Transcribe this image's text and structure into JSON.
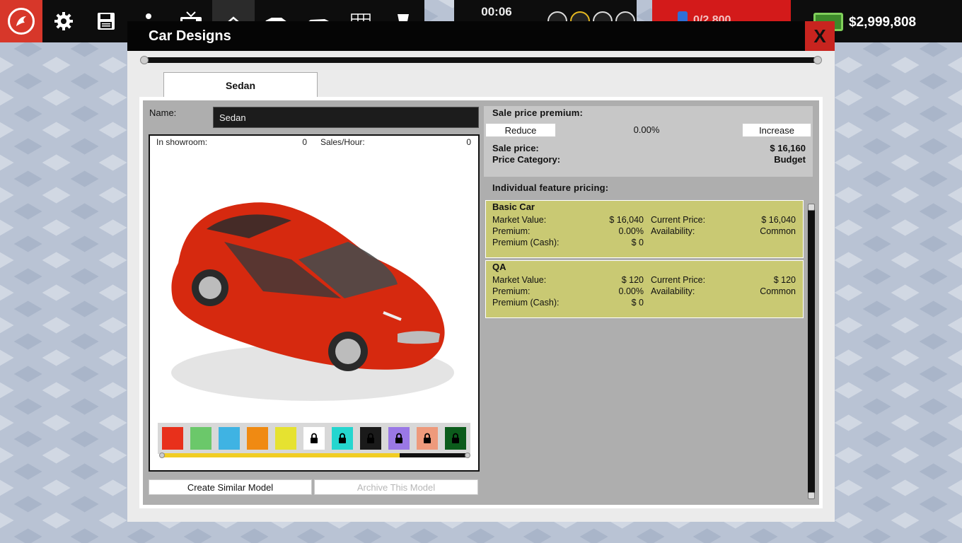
{
  "topbar": {
    "time": "00:06",
    "red_indicator_text": "0/2,800",
    "money": "$2,999,808",
    "icons": [
      "logo-icon",
      "gear-icon",
      "save-icon",
      "worker-icon",
      "tv-icon",
      "factory-icon",
      "car-icon",
      "sedan-icon",
      "grid-icon",
      "trophy-icon"
    ],
    "speed_buttons": [
      "pause-icon",
      "play-icon",
      "fast-forward-icon",
      "fastest-forward-icon"
    ]
  },
  "dialog": {
    "title": "Car Designs",
    "close_label": "X",
    "tab_label": "Sedan"
  },
  "design": {
    "name_label": "Name:",
    "name_value": "Sedan",
    "showroom_label": "In showroom:",
    "showroom_value": "0",
    "sales_label": "Sales/Hour:",
    "sales_value": "0",
    "car_color": "#d6290f",
    "swatches": [
      {
        "color": "#e8301b",
        "locked": false
      },
      {
        "color": "#6bc86a",
        "locked": false
      },
      {
        "color": "#3fb3e3",
        "locked": false
      },
      {
        "color": "#f08a12",
        "locked": false
      },
      {
        "color": "#e6e230",
        "locked": false
      },
      {
        "color": "#ffffff",
        "locked": true
      },
      {
        "color": "#25d6cf",
        "locked": true
      },
      {
        "color": "#1a1a1a",
        "locked": true
      },
      {
        "color": "#9a78e6",
        "locked": true
      },
      {
        "color": "#ee9a7c",
        "locked": true
      },
      {
        "color": "#0c5c1c",
        "locked": true
      }
    ],
    "swatch_scroll_fraction": 0.78,
    "create_similar_label": "Create Similar Model",
    "archive_label": "Archive This Model"
  },
  "pricing": {
    "premium_title": "Sale price premium:",
    "reduce_label": "Reduce",
    "premium_value": "0.00%",
    "increase_label": "Increase",
    "sale_price_label": "Sale price:",
    "sale_price_value": "$ 16,160",
    "category_label": "Price Category:",
    "category_value": "Budget",
    "features_title": "Individual feature pricing:",
    "features": [
      {
        "name": "Basic Car",
        "market_value_label": "Market Value:",
        "market_value": "$ 16,040",
        "premium_label": "Premium:",
        "premium": "0.00%",
        "premium_cash_label": "Premium (Cash):",
        "premium_cash": "$ 0",
        "current_price_label": "Current Price:",
        "current_price": "$ 16,040",
        "availability_label": "Availability:",
        "availability": "Common"
      },
      {
        "name": "QA",
        "market_value_label": "Market Value:",
        "market_value": "$ 120",
        "premium_label": "Premium:",
        "premium": "0.00%",
        "premium_cash_label": "Premium (Cash):",
        "premium_cash": "$ 0",
        "current_price_label": "Current Price:",
        "current_price": "$ 120",
        "availability_label": "Availability:",
        "availability": "Common"
      }
    ]
  }
}
